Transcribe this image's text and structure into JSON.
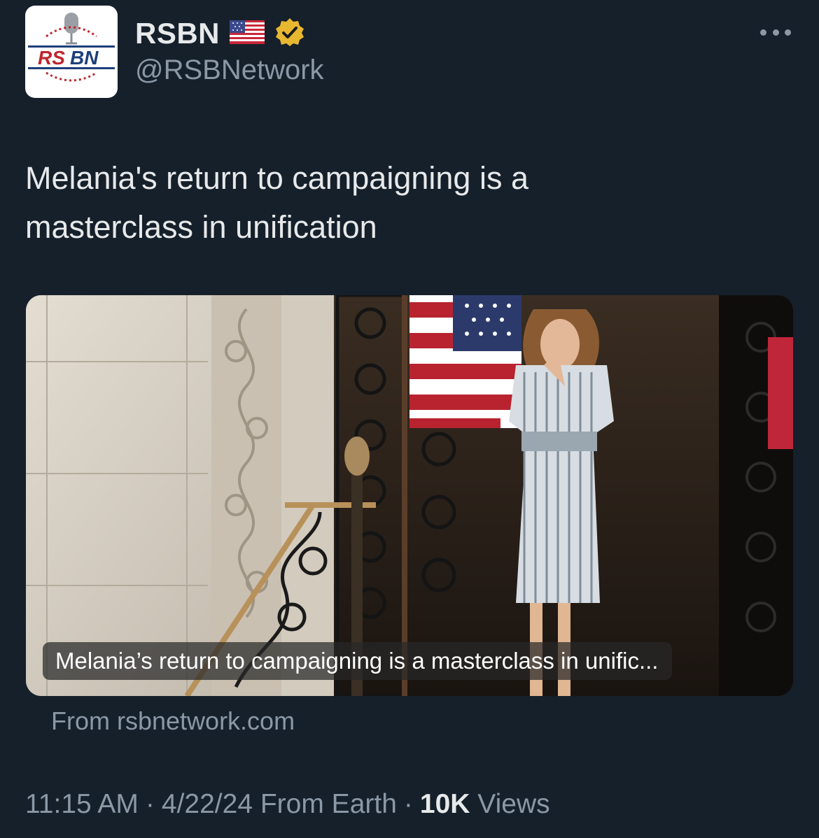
{
  "author": {
    "name": "RSBN",
    "handle": "@RSBNetwork",
    "flag_emoji": "🇺🇸",
    "verified_icon": "gold-verified-badge-icon",
    "avatar_logo_text": "RSBN"
  },
  "tweet": {
    "text_line1": "Melania's return to campaigning is a",
    "text_line2": "masterclass in unification"
  },
  "link_card": {
    "caption": "Melania’s return to campaigning is a masterclass in unific...",
    "source": "From rsbnetwork.com"
  },
  "meta": {
    "time": "11:15 AM",
    "date": "4/22/24",
    "location": "From Earth",
    "views_count": "10K",
    "views_label": "Views",
    "separator": "·"
  },
  "colors": {
    "background": "#15202b",
    "text_primary": "#e7e9ea",
    "text_secondary": "#8b98a5",
    "verified_gold": "#e8b730"
  },
  "icons": {
    "more": "more-horizontal-icon"
  }
}
